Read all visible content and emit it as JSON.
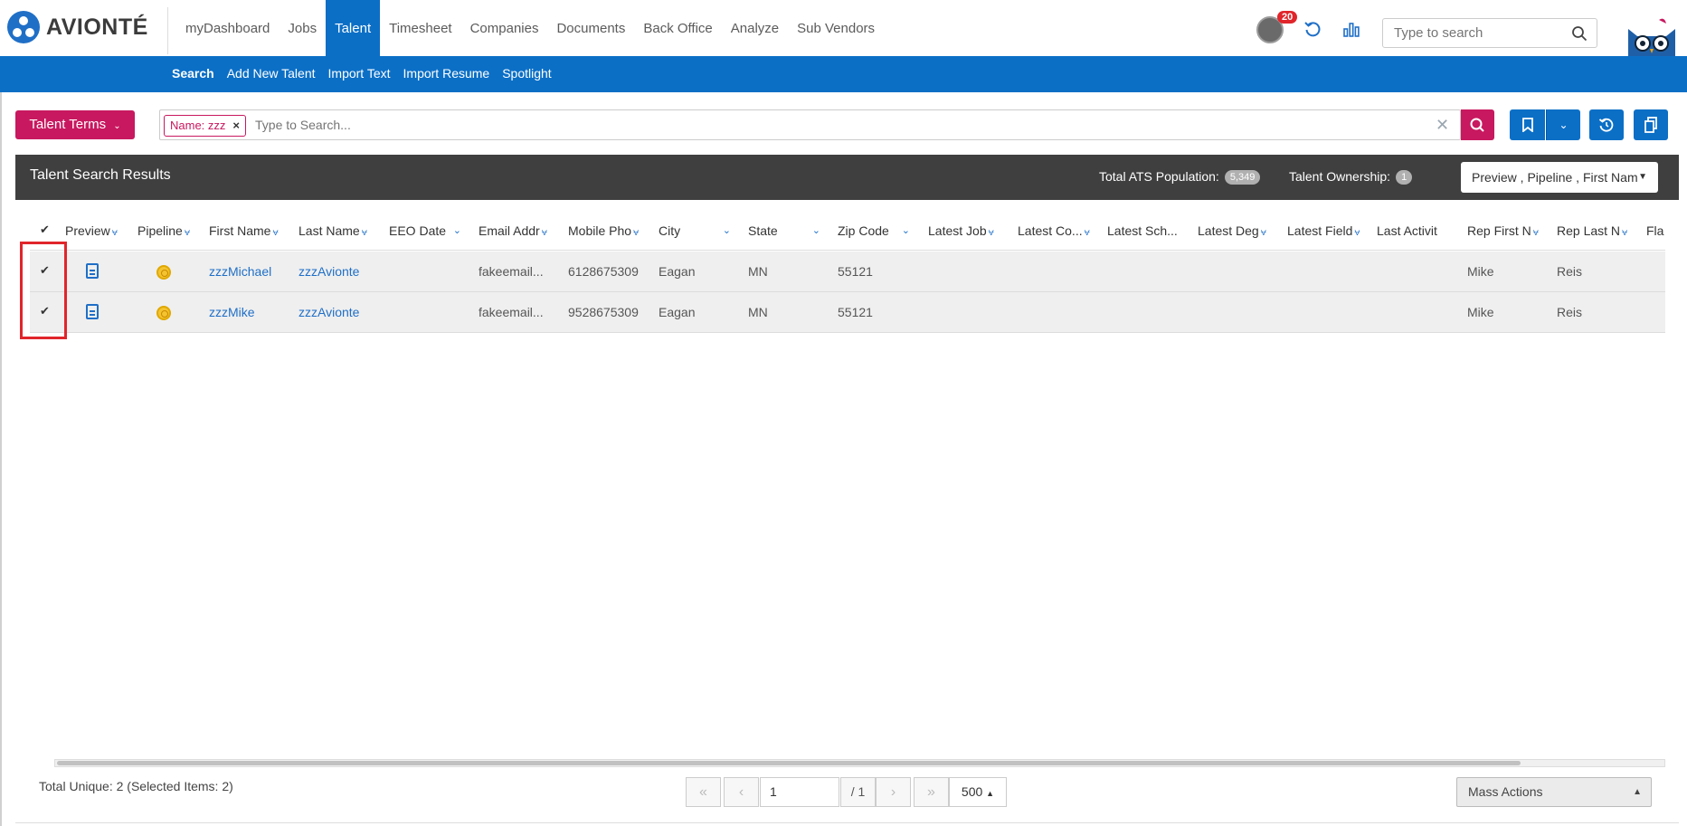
{
  "brand": {
    "name": "AVIONTÉ",
    "accent": "#0b6fc6",
    "primary_action": "#c8185f"
  },
  "main_nav": [
    {
      "label": "myDashboard",
      "active": false
    },
    {
      "label": "Jobs",
      "active": false
    },
    {
      "label": "Talent",
      "active": true
    },
    {
      "label": "Timesheet",
      "active": false
    },
    {
      "label": "Companies",
      "active": false
    },
    {
      "label": "Documents",
      "active": false
    },
    {
      "label": "Back Office",
      "active": false
    },
    {
      "label": "Analyze",
      "active": false
    },
    {
      "label": "Sub Vendors",
      "active": false
    }
  ],
  "header": {
    "notification_count": "20",
    "search_placeholder": "Type to search",
    "icons": [
      "user-avatar-icon",
      "refresh-icon",
      "bar-chart-icon",
      "search-icon",
      "owl-mascot-icon"
    ]
  },
  "sub_nav": [
    {
      "label": "Search",
      "active": true
    },
    {
      "label": "Add New Talent",
      "active": false
    },
    {
      "label": "Import Text",
      "active": false
    },
    {
      "label": "Import Resume",
      "active": false
    },
    {
      "label": "Spotlight",
      "active": false
    }
  ],
  "toolbar": {
    "terms_button": "Talent Terms",
    "filter_chip": "Name: zzz",
    "search_placeholder": "Type to Search..."
  },
  "results": {
    "title": "Talent Search Results",
    "population_label": "Total ATS Population:",
    "population_value": "5,349",
    "ownership_label": "Talent Ownership:",
    "ownership_value": "1",
    "column_selector": "Preview , Pipeline , First Nam"
  },
  "columns": [
    "Preview",
    "Pipeline",
    "First Name",
    "Last Name",
    "EEO Date",
    "Email Addr",
    "Mobile Pho",
    "City",
    "State",
    "Zip Code",
    "Latest Job",
    "Latest Co...",
    "Latest Sch...",
    "Latest Deg",
    "Latest Field",
    "Last Activit",
    "Rep First N",
    "Rep Last N",
    "Fla"
  ],
  "rows": [
    {
      "first_name": "zzzMichael",
      "last_name": "zzzAvionte",
      "eeo_date": "",
      "email": "fakeemail...",
      "mobile": "6128675309",
      "city": "Eagan",
      "state": "MN",
      "zip": "55121",
      "rep_first": "Mike",
      "rep_last": "Reis"
    },
    {
      "first_name": "zzzMike",
      "last_name": "zzzAvionte",
      "eeo_date": "",
      "email": "fakeemail...",
      "mobile": "9528675309",
      "city": "Eagan",
      "state": "MN",
      "zip": "55121",
      "rep_first": "Mike",
      "rep_last": "Reis"
    }
  ],
  "footer": {
    "total": "Total Unique: 2 (Selected Items: 2)",
    "page": "1",
    "of_pages": "/ 1",
    "page_size": "500",
    "mass_actions": "Mass Actions"
  }
}
